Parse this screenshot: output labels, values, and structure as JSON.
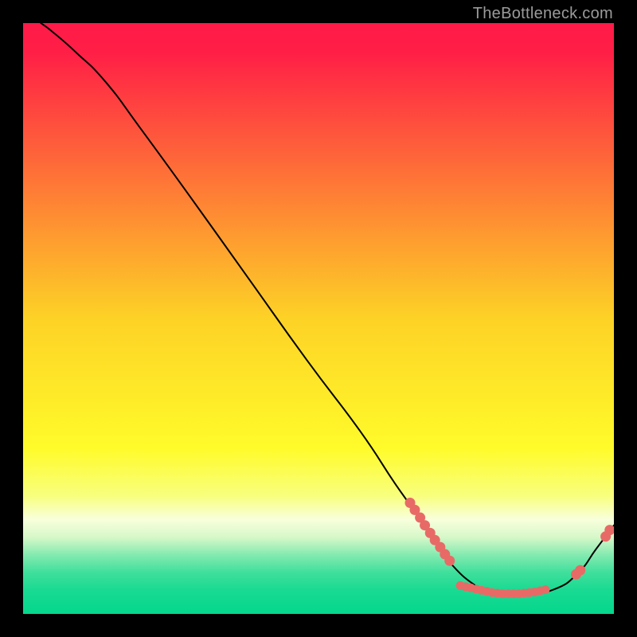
{
  "watermark": "TheBottleneck.com",
  "colors": {
    "mark": "#e86a66",
    "line": "#000000"
  },
  "chart_data": {
    "type": "line",
    "title": "",
    "xlabel": "",
    "ylabel": "",
    "xlim": [
      0,
      100
    ],
    "ylim": [
      0,
      100
    ],
    "gradient_stops": [
      {
        "offset": 0.0,
        "color": "#ff1a48"
      },
      {
        "offset": 0.05,
        "color": "#ff1f46"
      },
      {
        "offset": 0.5,
        "color": "#fdd226"
      },
      {
        "offset": 0.72,
        "color": "#fffb2a"
      },
      {
        "offset": 0.8,
        "color": "#f8ff7d"
      },
      {
        "offset": 0.84,
        "color": "#f8ffdc"
      },
      {
        "offset": 0.87,
        "color": "#d7f8c9"
      },
      {
        "offset": 0.9,
        "color": "#84eab0"
      },
      {
        "offset": 0.93,
        "color": "#3fdf9c"
      },
      {
        "offset": 0.96,
        "color": "#19da92"
      },
      {
        "offset": 1.0,
        "color": "#04d78c"
      }
    ],
    "curve": [
      {
        "x": 3,
        "y": 100
      },
      {
        "x": 5,
        "y": 98.5
      },
      {
        "x": 9,
        "y": 95
      },
      {
        "x": 14,
        "y": 90
      },
      {
        "x": 20,
        "y": 82
      },
      {
        "x": 28,
        "y": 71
      },
      {
        "x": 38,
        "y": 57
      },
      {
        "x": 48,
        "y": 43
      },
      {
        "x": 57,
        "y": 31
      },
      {
        "x": 63,
        "y": 22
      },
      {
        "x": 68,
        "y": 15
      },
      {
        "x": 72,
        "y": 9
      },
      {
        "x": 77,
        "y": 4.5
      },
      {
        "x": 80,
        "y": 3.5
      },
      {
        "x": 85,
        "y": 3.4
      },
      {
        "x": 90,
        "y": 4.2
      },
      {
        "x": 94,
        "y": 7
      },
      {
        "x": 97,
        "y": 11
      },
      {
        "x": 100,
        "y": 15
      }
    ],
    "marks_cluster_left": [
      {
        "x": 65.5,
        "y": 18.8
      },
      {
        "x": 66.3,
        "y": 17.6
      },
      {
        "x": 67.2,
        "y": 16.3
      },
      {
        "x": 68.0,
        "y": 15.0
      },
      {
        "x": 68.9,
        "y": 13.7
      },
      {
        "x": 69.7,
        "y": 12.5
      },
      {
        "x": 70.6,
        "y": 11.3
      },
      {
        "x": 71.4,
        "y": 10.1
      },
      {
        "x": 72.2,
        "y": 9.0
      }
    ],
    "marks_flat": [
      {
        "x": 74.0,
        "y": 4.8
      },
      {
        "x": 74.9,
        "y": 4.6
      },
      {
        "x": 75.8,
        "y": 4.4
      },
      {
        "x": 76.7,
        "y": 4.2
      },
      {
        "x": 77.6,
        "y": 4.0
      },
      {
        "x": 78.5,
        "y": 3.8
      },
      {
        "x": 79.4,
        "y": 3.6
      },
      {
        "x": 80.3,
        "y": 3.5
      },
      {
        "x": 81.2,
        "y": 3.4
      },
      {
        "x": 82.1,
        "y": 3.4
      },
      {
        "x": 83.0,
        "y": 3.4
      },
      {
        "x": 83.9,
        "y": 3.4
      },
      {
        "x": 84.8,
        "y": 3.5
      },
      {
        "x": 85.7,
        "y": 3.6
      },
      {
        "x": 86.6,
        "y": 3.7
      },
      {
        "x": 87.5,
        "y": 3.9
      },
      {
        "x": 88.4,
        "y": 4.1
      }
    ],
    "marks_right": [
      {
        "x": 93.6,
        "y": 6.7
      },
      {
        "x": 94.3,
        "y": 7.4
      }
    ],
    "marks_far_right": [
      {
        "x": 98.6,
        "y": 13.1
      },
      {
        "x": 99.3,
        "y": 14.2
      }
    ]
  }
}
